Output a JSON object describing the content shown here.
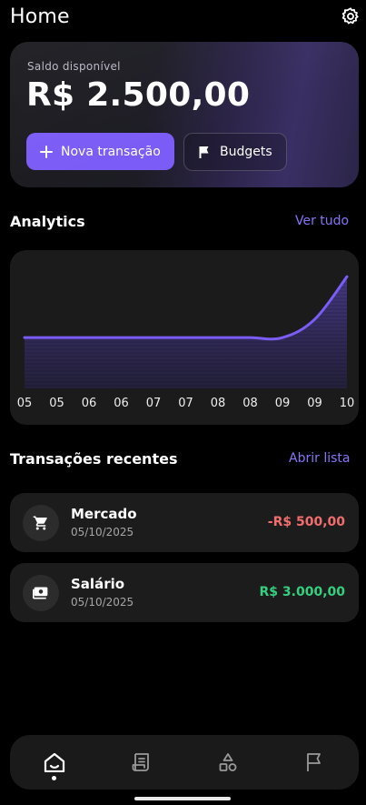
{
  "header": {
    "title": "Home",
    "settings_icon": "gear-icon"
  },
  "balance": {
    "label": "Saldo disponível",
    "value": "R$ 2.500,00",
    "primary_button": {
      "label": "Nova transação",
      "icon": "plus-icon"
    },
    "secondary_button": {
      "label": "Budgets",
      "icon": "flag-icon"
    }
  },
  "analytics": {
    "title": "Analytics",
    "link": "Ver tudo"
  },
  "chart_data": {
    "type": "area",
    "x": [
      "05",
      "05",
      "06",
      "06",
      "07",
      "07",
      "08",
      "08",
      "09",
      "09",
      "10"
    ],
    "values": [
      2500,
      2500,
      2500,
      2500,
      2500,
      2500,
      2500,
      2500,
      2500,
      3400,
      5500
    ],
    "ylim": [
      0,
      6000
    ],
    "grid": false,
    "colors": {
      "line": "#7b5cf6",
      "fill": "#3d3270"
    }
  },
  "recent": {
    "title": "Transações recentes",
    "link": "Abrir lista",
    "transactions": [
      {
        "icon": "cart-icon",
        "name": "Mercado",
        "date": "05/10/2025",
        "amount": "-R$ 500,00",
        "color": "#f26d6d"
      },
      {
        "icon": "cash-icon",
        "name": "Salário",
        "date": "05/10/2025",
        "amount": "R$ 3.000,00",
        "color": "#35d07f"
      }
    ]
  },
  "nav": {
    "items": [
      {
        "icon": "home-icon",
        "active": true
      },
      {
        "icon": "receipt-icon",
        "active": false
      },
      {
        "icon": "categories-icon",
        "active": false
      },
      {
        "icon": "flag-icon",
        "active": false
      }
    ]
  },
  "colors": {
    "accent": "#7b5cf6",
    "negative": "#f26d6d",
    "positive": "#35d07f",
    "background": "#000000"
  }
}
